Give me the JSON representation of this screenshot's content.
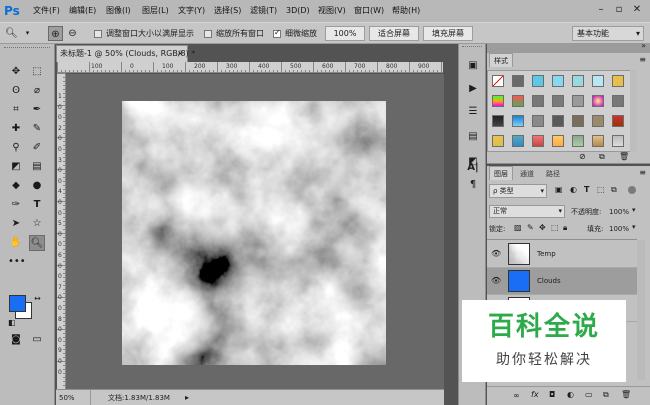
{
  "app": {
    "logo": "Ps",
    "menu": [
      "文件(F)",
      "编辑(E)",
      "图像(I)",
      "图层(L)",
      "文字(Y)",
      "选择(S)",
      "滤镜(T)",
      "3D(D)",
      "视图(V)",
      "窗口(W)",
      "帮助(H)"
    ]
  },
  "options": {
    "resize_label": "调整窗口大小以满屏显示",
    "zoom_all_label": "缩放所有窗口",
    "scrubby_label": "细微缩放",
    "zoom100": "100%",
    "fit_screen": "适合屏幕",
    "fill_screen": "填充屏幕",
    "workspace": "基本功能",
    "resize_checked": false,
    "zoom_all_checked": false,
    "scrubby_checked": true
  },
  "document": {
    "tab_title": "未标题-1 @ 50% (Clouds, RGB/8) *",
    "ruler_top": [
      "100",
      "0",
      "100",
      "200",
      "300",
      "400",
      "500",
      "600",
      "700",
      "800",
      "900"
    ],
    "ruler_left": [
      "1",
      "0",
      "0",
      "2",
      "0",
      "0",
      "3",
      "0",
      "0",
      "4",
      "0",
      "0",
      "5",
      "0",
      "0",
      "6",
      "0",
      "0",
      "7",
      "0",
      "0",
      "8",
      "0",
      "0",
      "9",
      "0",
      "0"
    ]
  },
  "status": {
    "zoom": "50%",
    "doc_size": "文档:1.83M/1.83M"
  },
  "colors": {
    "foreground": "#1a6ef5",
    "background": "#ffffff"
  },
  "styles_panel": {
    "tab": "样式"
  },
  "layers_panel": {
    "tabs": [
      "图层",
      "通道",
      "路径"
    ],
    "filter_label": "ρ 类型",
    "blend_mode": "正常",
    "opacity_label": "不透明度:",
    "opacity_value": "100%",
    "lock_label": "锁定:",
    "fill_label": "填充:",
    "fill_value": "100%",
    "layers": [
      {
        "name": "Temp"
      },
      {
        "name": "Clouds"
      }
    ]
  },
  "watermark": {
    "main": "百科全说",
    "sub": "助你轻松解决"
  }
}
